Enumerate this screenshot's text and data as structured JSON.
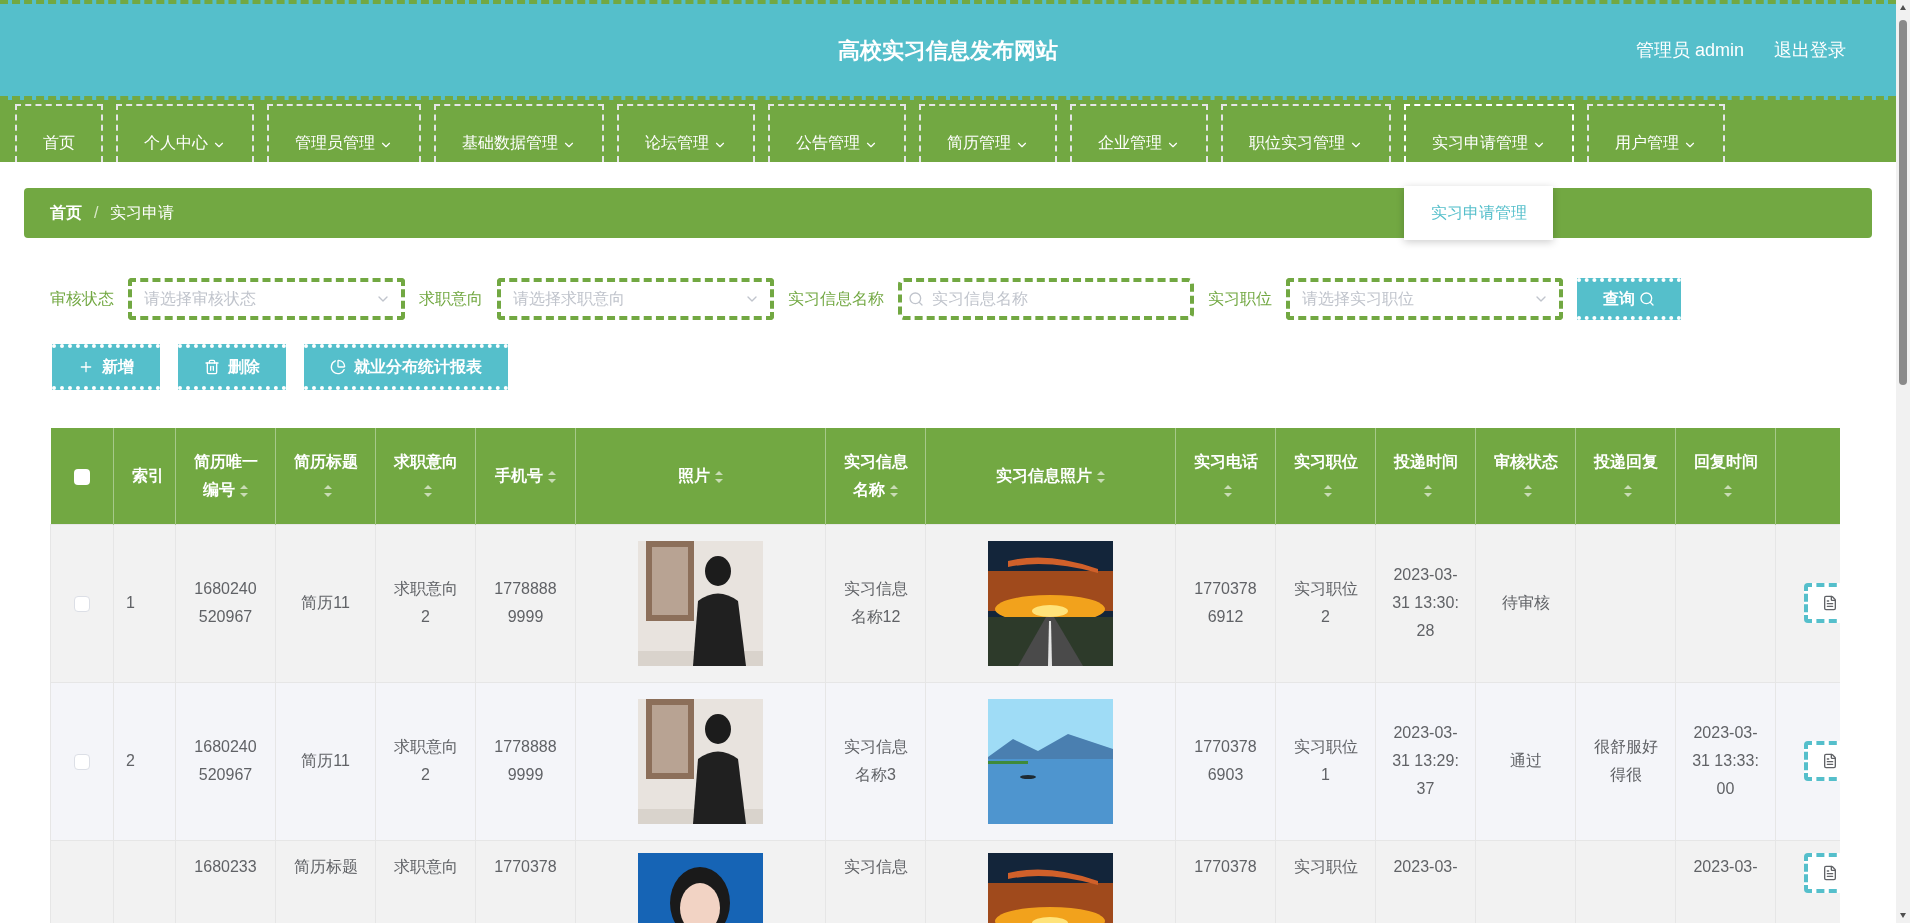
{
  "header": {
    "title": "高校实习信息发布网站",
    "user": "管理员 admin",
    "logout": "退出登录"
  },
  "nav": [
    {
      "label": "首页",
      "kind": "link",
      "expanded": false
    },
    {
      "label": "个人中心",
      "kind": "menu",
      "expanded": false
    },
    {
      "label": "管理员管理",
      "kind": "menu",
      "expanded": false
    },
    {
      "label": "基础数据管理",
      "kind": "menu",
      "expanded": false
    },
    {
      "label": "论坛管理",
      "kind": "menu",
      "expanded": false
    },
    {
      "label": "公告管理",
      "kind": "menu",
      "expanded": false
    },
    {
      "label": "简历管理",
      "kind": "menu",
      "expanded": false
    },
    {
      "label": "企业管理",
      "kind": "menu",
      "expanded": false
    },
    {
      "label": "职位实习管理",
      "kind": "menu",
      "expanded": false
    },
    {
      "label": "实习申请管理",
      "kind": "menu",
      "expanded": true,
      "submenu": [
        "实习申请管理"
      ]
    },
    {
      "label": "用户管理",
      "kind": "menu",
      "expanded": false
    }
  ],
  "breadcrumb": [
    "首页",
    "实习申请"
  ],
  "breadcrumb_separator": "/",
  "filters": [
    {
      "label": "审核状态",
      "kind": "select",
      "placeholder": "请选择审核状态"
    },
    {
      "label": "求职意向",
      "kind": "select",
      "placeholder": "请选择求职意向"
    },
    {
      "label": "实习信息名称",
      "kind": "search",
      "placeholder": "实习信息名称"
    },
    {
      "label": "实习职位",
      "kind": "select",
      "placeholder": "请选择实习职位"
    }
  ],
  "search_button": "查询",
  "actions": [
    {
      "label": "新增",
      "kind": "add"
    },
    {
      "label": "删除",
      "kind": "delete"
    },
    {
      "label": "就业分布统计报表",
      "kind": "chart"
    }
  ],
  "table": {
    "select_all": {
      "checked": false
    },
    "columns": [
      {
        "label": "索引",
        "kind": "text",
        "sortable": false
      },
      {
        "label": "简历唯一编号",
        "kind": "text",
        "sortable": true
      },
      {
        "label": "简历标题",
        "kind": "text",
        "sortable": true
      },
      {
        "label": "求职意向",
        "kind": "text",
        "sortable": true
      },
      {
        "label": "手机号",
        "kind": "text",
        "sortable": true
      },
      {
        "label": "照片",
        "kind": "picture",
        "sortable": true
      },
      {
        "label": "实习信息名称",
        "kind": "text",
        "sortable": true
      },
      {
        "label": "实习信息照片",
        "kind": "picture",
        "sortable": true
      },
      {
        "label": "实习电话",
        "kind": "text",
        "sortable": true
      },
      {
        "label": "实习职位",
        "kind": "text",
        "sortable": true
      },
      {
        "label": "投递时间",
        "kind": "text",
        "sortable": true
      },
      {
        "label": "审核状态",
        "kind": "text",
        "sortable": true
      },
      {
        "label": "投递回复",
        "kind": "text",
        "sortable": true
      },
      {
        "label": "回复时间",
        "kind": "text",
        "sortable": true
      },
      {
        "kind": "action"
      }
    ],
    "rows": [
      {
        "checked": false,
        "cells": [
          "1",
          "1680240520967",
          "简历11",
          "求职意向2",
          "17788889999",
          null,
          "实习信息名称12",
          null,
          "17703786912",
          "实习职位2",
          "2023-03-31 13:30:28",
          "待审核",
          null,
          null,
          null
        ]
      },
      {
        "checked": false,
        "cells": [
          "2",
          "1680240520967",
          "简历11",
          "求职意向2",
          "17788889999",
          null,
          "实习信息名称3",
          null,
          "17703786903",
          "实习职位1",
          "2023-03-31 13:29:37",
          "通过",
          "很舒服好得很",
          "2023-03-31 13:33:00",
          null
        ]
      },
      {
        "cells": [
          null,
          "1680233",
          "简历标题",
          "求职意向",
          "1770378",
          null,
          "实习信息",
          null,
          "1770378",
          "实习职位",
          "2023-03-",
          null,
          null,
          "2023-03-",
          null
        ]
      }
    ]
  }
}
